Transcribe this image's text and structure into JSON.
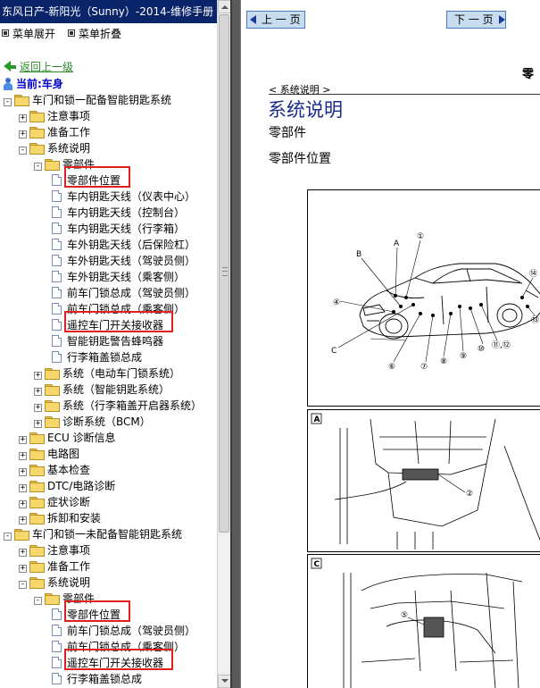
{
  "window": {
    "title": "东风日产-新阳光（Sunny）-2014-维修手册"
  },
  "menu": {
    "expand_label": "菜单展开",
    "collapse_label": "菜单折叠"
  },
  "back_link": "返回上一级",
  "current_location": "当前:车身",
  "tree": [
    {
      "label": "车门和锁一配备智能钥匙系统",
      "level": 0,
      "type": "folder",
      "state": "-"
    },
    {
      "label": "注意事项",
      "level": 1,
      "type": "folder",
      "state": "+"
    },
    {
      "label": "准备工作",
      "level": 1,
      "type": "folder",
      "state": "+"
    },
    {
      "label": "系统说明",
      "level": 1,
      "type": "folder",
      "state": "-"
    },
    {
      "label": "零部件",
      "level": 2,
      "type": "folder",
      "state": "-"
    },
    {
      "label": "零部件位置",
      "level": 3,
      "type": "doc",
      "highlight": true
    },
    {
      "label": "车内钥匙天线（仪表中心）",
      "level": 3,
      "type": "doc"
    },
    {
      "label": "车内钥匙天线（控制台）",
      "level": 3,
      "type": "doc"
    },
    {
      "label": "车内钥匙天线（行李箱）",
      "level": 3,
      "type": "doc"
    },
    {
      "label": "车外钥匙天线（后保险杠）",
      "level": 3,
      "type": "doc"
    },
    {
      "label": "车外钥匙天线（驾驶员侧）",
      "level": 3,
      "type": "doc"
    },
    {
      "label": "车外钥匙天线（乘客侧）",
      "level": 3,
      "type": "doc"
    },
    {
      "label": "前车门锁总成（驾驶员侧）",
      "level": 3,
      "type": "doc"
    },
    {
      "label": "前车门锁总成（乘客侧）",
      "level": 3,
      "type": "doc"
    },
    {
      "label": "遥控车门开关接收器",
      "level": 3,
      "type": "doc",
      "highlight": true
    },
    {
      "label": "智能钥匙警告蜂鸣器",
      "level": 3,
      "type": "doc"
    },
    {
      "label": "行李箱盖锁总成",
      "level": 3,
      "type": "doc"
    },
    {
      "label": "系统（电动车门锁系统）",
      "level": 2,
      "type": "folder",
      "state": "+"
    },
    {
      "label": "系统（智能钥匙系统）",
      "level": 2,
      "type": "folder",
      "state": "+"
    },
    {
      "label": "系统（行李箱盖开启器系统）",
      "level": 2,
      "type": "folder",
      "state": "+"
    },
    {
      "label": "诊断系统（BCM）",
      "level": 2,
      "type": "folder",
      "state": "+"
    },
    {
      "label": "ECU 诊断信息",
      "level": 1,
      "type": "folder",
      "state": "+"
    },
    {
      "label": "电路图",
      "level": 1,
      "type": "folder",
      "state": "+"
    },
    {
      "label": "基本检查",
      "level": 1,
      "type": "folder",
      "state": "+"
    },
    {
      "label": "DTC/电路诊断",
      "level": 1,
      "type": "folder",
      "state": "+"
    },
    {
      "label": "症状诊断",
      "level": 1,
      "type": "folder",
      "state": "+"
    },
    {
      "label": "拆卸和安装",
      "level": 1,
      "type": "folder",
      "state": "+"
    },
    {
      "label": "车门和锁一未配备智能钥匙系统",
      "level": 0,
      "type": "folder",
      "state": "-"
    },
    {
      "label": "注意事项",
      "level": 1,
      "type": "folder",
      "state": "+"
    },
    {
      "label": "准备工作",
      "level": 1,
      "type": "folder",
      "state": "+"
    },
    {
      "label": "系统说明",
      "level": 1,
      "type": "folder",
      "state": "-"
    },
    {
      "label": "零部件",
      "level": 2,
      "type": "folder",
      "state": "-"
    },
    {
      "label": "零部件位置",
      "level": 3,
      "type": "doc",
      "highlight": true
    },
    {
      "label": "前车门锁总成（驾驶员侧）",
      "level": 3,
      "type": "doc"
    },
    {
      "label": "前车门锁总成（乘客侧）",
      "level": 3,
      "type": "doc"
    },
    {
      "label": "遥控车门开关接收器",
      "level": 3,
      "type": "doc",
      "highlight": true
    },
    {
      "label": "行李箱盖锁总成",
      "level": 3,
      "type": "doc"
    }
  ],
  "nav": {
    "prev_label": "上 一 页",
    "next_label": "下 一 页"
  },
  "doc": {
    "top_title": "零",
    "breadcrumb": "< 系统说明 >",
    "section_title": "系统说明",
    "subsection": "零部件",
    "subsubsection": "零部件位置"
  },
  "figure": {
    "main_callouts": [
      "A",
      "①",
      "B",
      "④",
      "C",
      "⑥",
      "⑦",
      "⑧",
      "⑨",
      "⑩",
      "⑪,⑫",
      "⑭",
      "⑬"
    ],
    "detail_a_letter": "A",
    "detail_a_callout": "②",
    "detail_c_letter": "C",
    "detail_c_callout": "⑤"
  },
  "colors": {
    "titlebar": "#0a246a",
    "highlight": "#e02020",
    "doc_title": "#1a2a8a",
    "back_link": "#2a8a2a",
    "current": "#0000cc"
  }
}
